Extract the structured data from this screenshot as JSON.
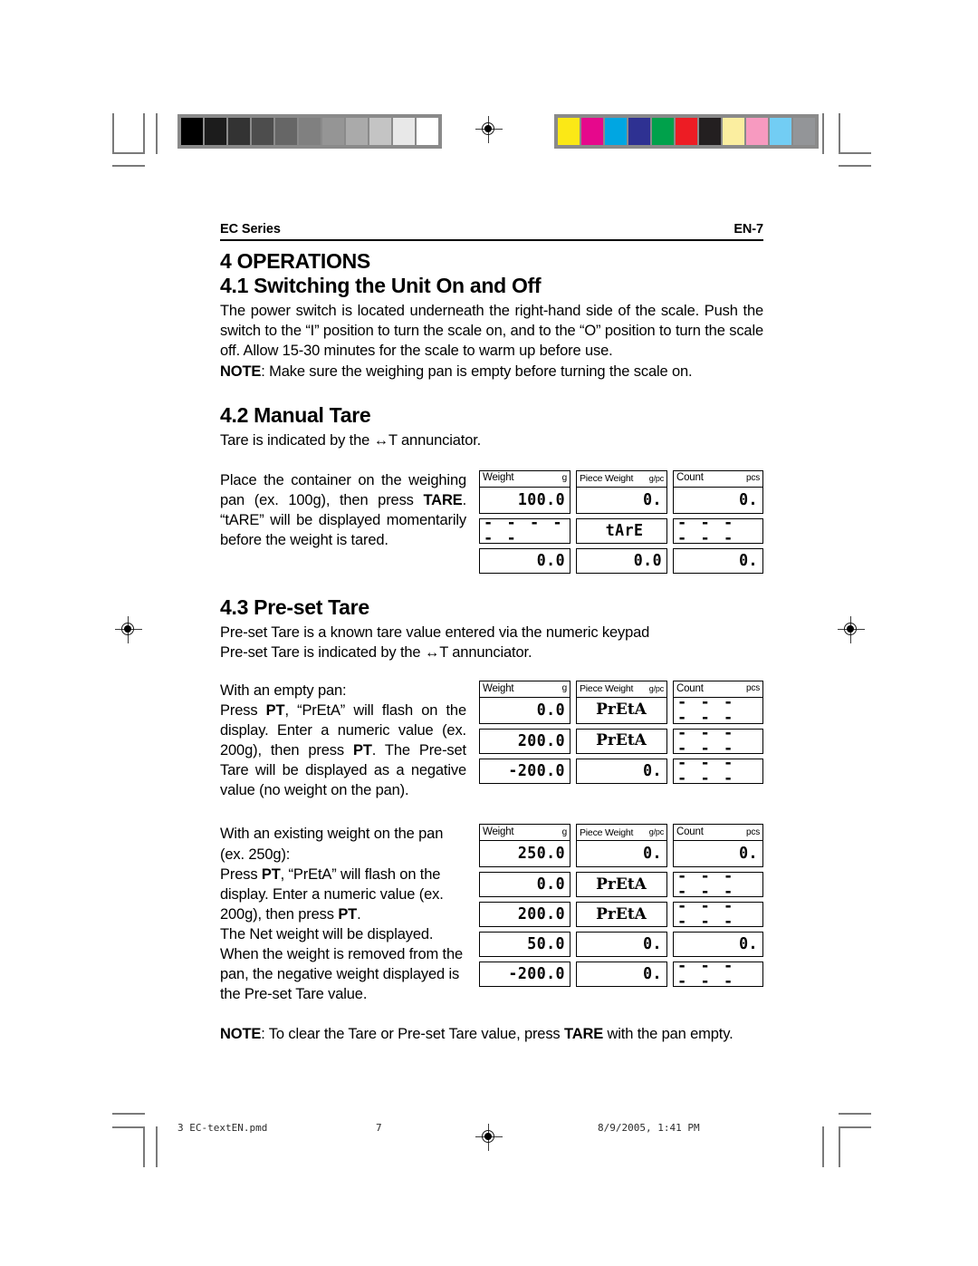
{
  "runhead": {
    "left": "EC Series",
    "right": "EN-7"
  },
  "sections": {
    "operations_title": "4 OPERATIONS",
    "s41": {
      "title": "4.1 Switching the Unit On and Off",
      "body": "The power switch is located underneath the right-hand side of the scale.  Push the switch to the “I” position to turn the scale on, and to the “O” position to turn the scale off.  Allow 15-30 minutes for the scale to warm up before use.",
      "note_label": "NOTE",
      "note_text": ": Make sure the weighing pan is empty before turning the scale on."
    },
    "s42": {
      "title": "4.2 Manual Tare",
      "intro": "Tare is indicated by the ↔T annunciator.",
      "body_1": "Place the container on the weighing pan (ex. 100g), then press ",
      "body_bold": "TARE",
      "body_2": ". “tARE” will be displayed momentarily before the weight is tared."
    },
    "s43": {
      "title": "4.3 Pre-set Tare",
      "intro_1": "Pre-set Tare is a known tare value entered via the numeric keypad",
      "intro_2": "Pre-set Tare is indicated by the ↔T annunciator.",
      "case1_head": "With an empty pan:",
      "case1_a": "Press ",
      "case1_b1": "PT",
      "case1_b": ", “PrEtA” will flash on the display.  Enter a numeric value (ex. 200g), then press ",
      "case1_b2": "PT",
      "case1_c": ".  The Pre-set Tare will be displayed as a negative value (no weight on the pan).",
      "case2_head_1": "With an existing weight on the pan",
      "case2_head_2": "(ex. 250g):",
      "case2_a": "Press ",
      "case2_b1": "PT",
      "case2_b": ", “PrEtA” will flash on the display.  Enter a numeric value (ex. 200g), then press ",
      "case2_b2": "PT",
      "case2_c": ".",
      "case2_d": "The Net weight will be displayed. When the weight is removed from the pan, the negative weight displayed is the Pre-set Tare value."
    },
    "final_note_label": "NOTE",
    "final_note_a": ": To clear the Tare or Pre-set Tare value, press ",
    "final_note_b": "TARE",
    "final_note_c": " with the pan empty."
  },
  "display_headers": {
    "weight": {
      "label": "Weight",
      "unit": "g"
    },
    "piece_weight": {
      "label": "Piece Weight",
      "unit": "g/pc"
    },
    "count": {
      "label": "Count",
      "unit": "pcs"
    }
  },
  "display_tables": [
    {
      "id": "manual-tare-display",
      "rows": [
        {
          "header": true,
          "weight": "100.0",
          "piece_weight": "0.",
          "count": "0."
        },
        {
          "header": false,
          "weight": "------",
          "piece_weight": "tArE",
          "count": "------"
        },
        {
          "header": false,
          "weight": "0.0",
          "piece_weight": "0.0",
          "count": "0."
        }
      ]
    },
    {
      "id": "preset-tare-empty-pan-display",
      "rows": [
        {
          "header": true,
          "weight": "0.0",
          "piece_weight": "PrEtA",
          "count": "------"
        },
        {
          "header": false,
          "weight": "200.0",
          "piece_weight": "PrEtA",
          "count": "------"
        },
        {
          "header": false,
          "weight": "-200.0",
          "piece_weight": "0.",
          "count": "------"
        }
      ]
    },
    {
      "id": "preset-tare-existing-weight-display",
      "rows": [
        {
          "header": true,
          "weight": "250.0",
          "piece_weight": "0.",
          "count": "0."
        },
        {
          "header": false,
          "weight": "0.0",
          "piece_weight": "PrEtA",
          "count": "------"
        },
        {
          "header": false,
          "weight": "200.0",
          "piece_weight": "PrEtA",
          "count": "------"
        },
        {
          "header": false,
          "weight": "50.0",
          "piece_weight": "0.",
          "count": "0."
        },
        {
          "header": false,
          "weight": "-200.0",
          "piece_weight": "0.",
          "count": "------"
        }
      ]
    }
  ],
  "prepress": {
    "grayscale_bar": [
      "#000000",
      "#1c1c1c",
      "#333333",
      "#4d4d4d",
      "#666666",
      "#808080",
      "#959595",
      "#aaaaaa",
      "#c4c4c4",
      "#e8e8e8",
      "#ffffff"
    ],
    "color_bar": [
      "#fbe816",
      "#e6088c",
      "#00a6e2",
      "#2e3192",
      "#00a14b",
      "#ed1c24",
      "#231f20",
      "#fbeea0",
      "#f79ac0",
      "#72cdf4",
      "#939598"
    ]
  },
  "footer": {
    "file": "3   EC-textEN.pmd",
    "page": "7",
    "date": "8/9/2005, 1:41 PM"
  }
}
